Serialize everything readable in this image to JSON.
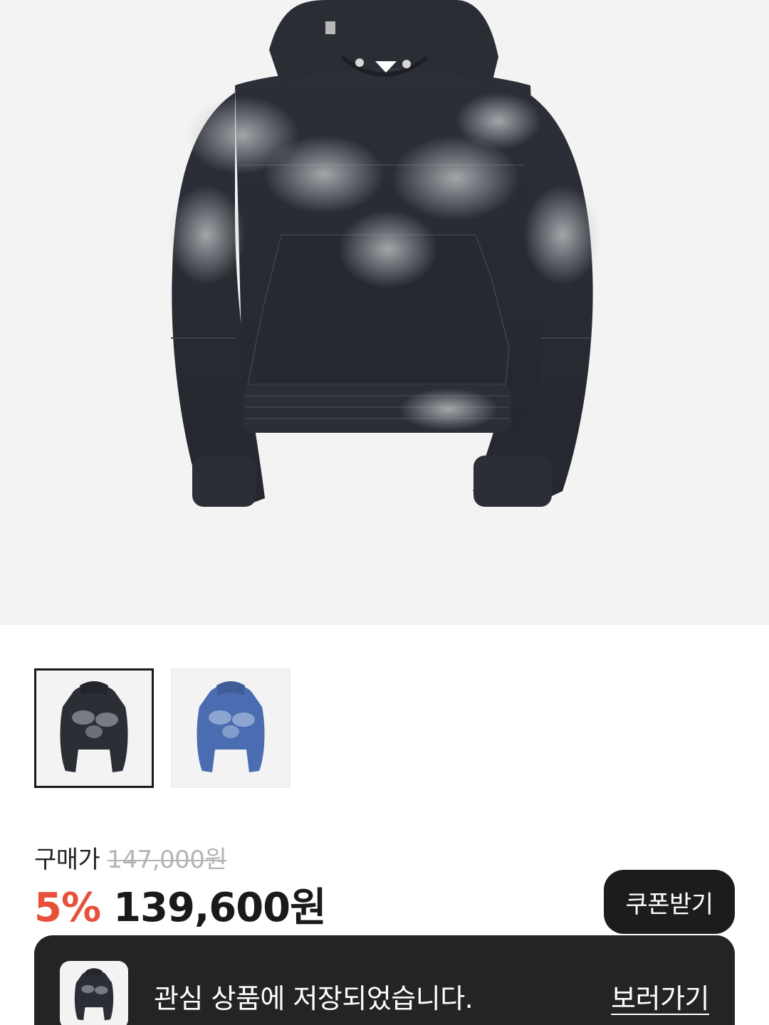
{
  "product": {
    "main_image": "black-washed-hoodie",
    "thumbnails": [
      {
        "image": "black-washed-hoodie",
        "selected": true
      },
      {
        "image": "blue-washed-hoodie",
        "selected": false
      }
    ]
  },
  "price": {
    "label": "구매가",
    "original": "147,000원",
    "discount": "5%",
    "sale": "139,600원"
  },
  "coupon": {
    "button_label": "쿠폰받기"
  },
  "toast": {
    "message": "관심 상품에 저장되었습니다.",
    "link_label": "보러가기"
  },
  "colors": {
    "discount": "#e8503a",
    "dark_button": "#1c1c1c",
    "toast_bg": "#242424",
    "image_bg": "#f3f3f3"
  }
}
